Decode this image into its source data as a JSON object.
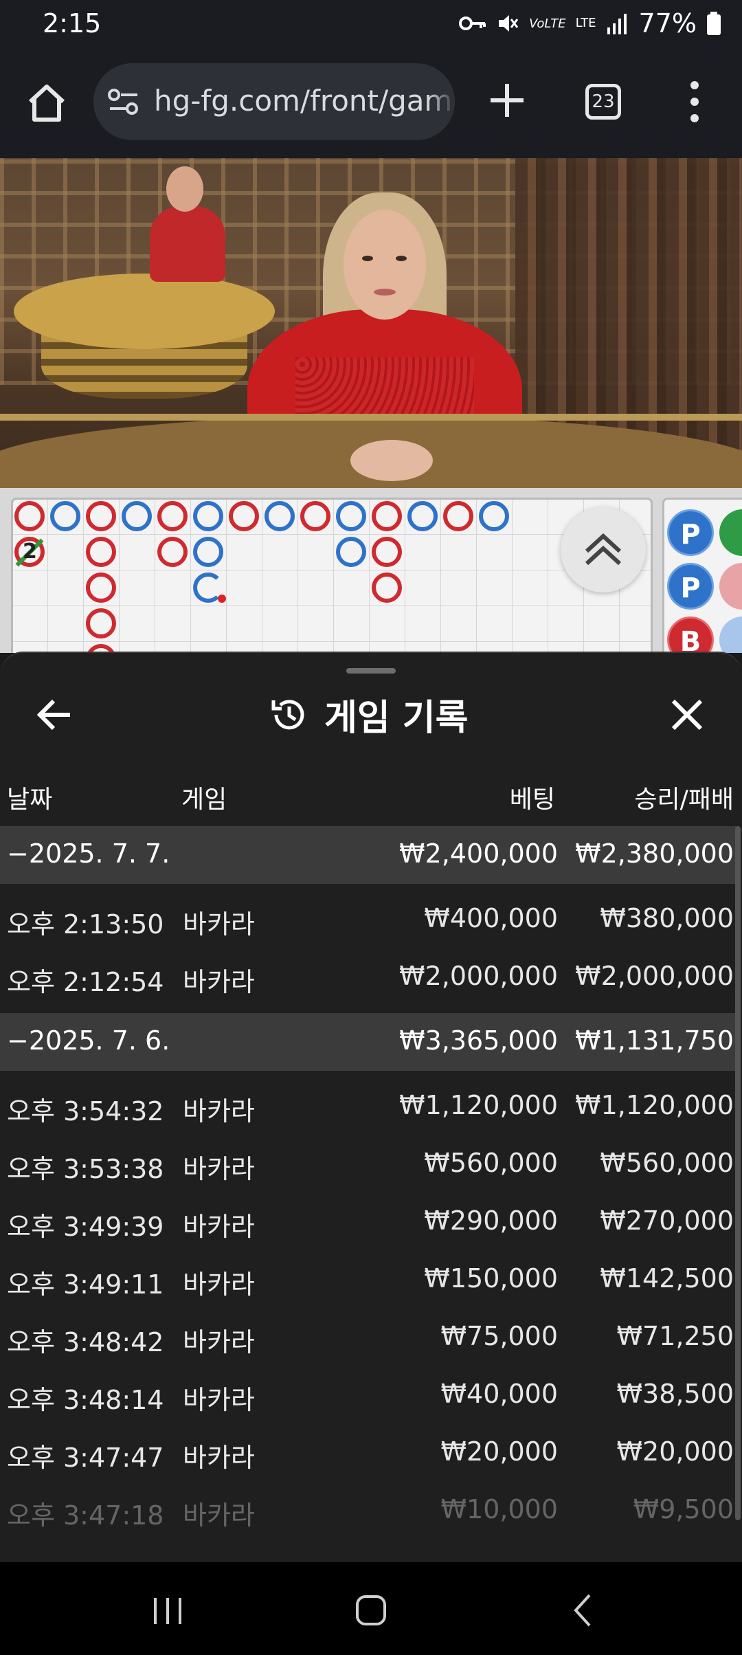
{
  "status": {
    "time": "2:15",
    "battery": "77%",
    "icons": [
      "key-icon",
      "mute-icon",
      "volte-icon",
      "lte-icon",
      "signal-icon",
      "battery-icon"
    ],
    "volte_label": "VoLTE",
    "lte_label": "LTE"
  },
  "browser": {
    "url": "hg-fg.com/front/gam",
    "tab_count": "23"
  },
  "scoreboard": {
    "bigroad_number": "2",
    "bead_labels": [
      "P",
      "P",
      "B"
    ]
  },
  "sheet": {
    "title": "게임 기록",
    "columns": {
      "date": "날짜",
      "game": "게임",
      "bet": "베팅",
      "win": "승리/패배"
    },
    "groups": [
      {
        "date": "−2025. 7. 7.",
        "bet": "₩2,400,000",
        "win": "₩2,380,000",
        "rows": [
          {
            "time": "오후 2:13:50",
            "game": "바카라",
            "bet": "₩400,000",
            "win": "₩380,000"
          },
          {
            "time": "오후 2:12:54",
            "game": "바카라",
            "bet": "₩2,000,000",
            "win": "₩2,000,000"
          }
        ]
      },
      {
        "date": "−2025. 7. 6.",
        "bet": "₩3,365,000",
        "win": "₩1,131,750",
        "rows": [
          {
            "time": "오후 3:54:32",
            "game": "바카라",
            "bet": "₩1,120,000",
            "win": "₩1,120,000"
          },
          {
            "time": "오후 3:53:38",
            "game": "바카라",
            "bet": "₩560,000",
            "win": "₩560,000"
          },
          {
            "time": "오후 3:49:39",
            "game": "바카라",
            "bet": "₩290,000",
            "win": "₩270,000"
          },
          {
            "time": "오후 3:49:11",
            "game": "바카라",
            "bet": "₩150,000",
            "win": "₩142,500"
          },
          {
            "time": "오후 3:48:42",
            "game": "바카라",
            "bet": "₩75,000",
            "win": "₩71,250"
          },
          {
            "time": "오후 3:48:14",
            "game": "바카라",
            "bet": "₩40,000",
            "win": "₩38,500"
          },
          {
            "time": "오후 3:47:47",
            "game": "바카라",
            "bet": "₩20,000",
            "win": "₩20,000"
          },
          {
            "time": "오후 3:47:18",
            "game": "바카라",
            "bet": "₩10,000",
            "win": "₩9,500"
          }
        ]
      }
    ]
  },
  "colors": {
    "banker": "#cf2a2f",
    "player": "#2f72c9",
    "tie": "#2d9a3a"
  }
}
